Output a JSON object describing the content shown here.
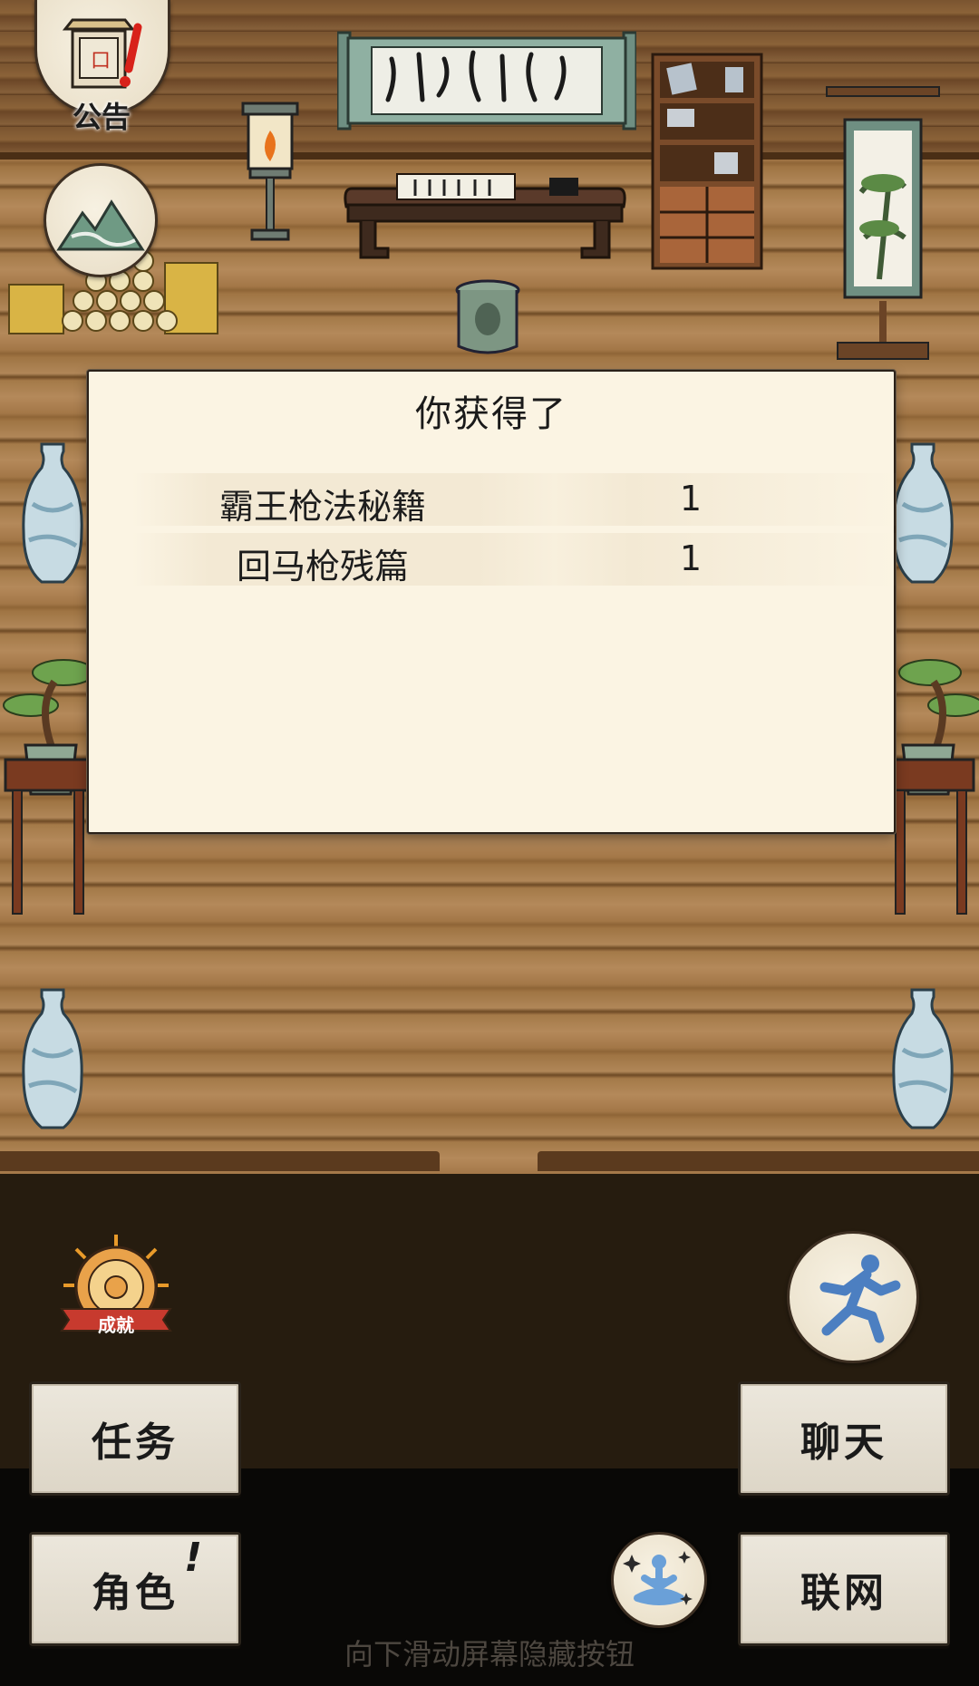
{
  "top_left": {
    "notice_label": "公告"
  },
  "modal": {
    "title": "你获得了",
    "items": [
      {
        "name": "霸王枪法秘籍",
        "qty": "1"
      },
      {
        "name": "回马枪残篇",
        "qty": "1"
      }
    ]
  },
  "buttons": {
    "task": "任务",
    "chat": "聊天",
    "role": "角色",
    "role_alert": "!",
    "network": "联网",
    "achievement_ribbon": "成就"
  },
  "hint": "向下滑动屏幕隐藏按钮",
  "icons": [
    "notice-icon",
    "landscape-map-icon",
    "achievement-icon",
    "run-icon",
    "meditate-icon"
  ],
  "colors": {
    "modal_bg": "#fbf4e3",
    "button_bg": "#ece7dc",
    "alert_red": "#d8221a"
  }
}
